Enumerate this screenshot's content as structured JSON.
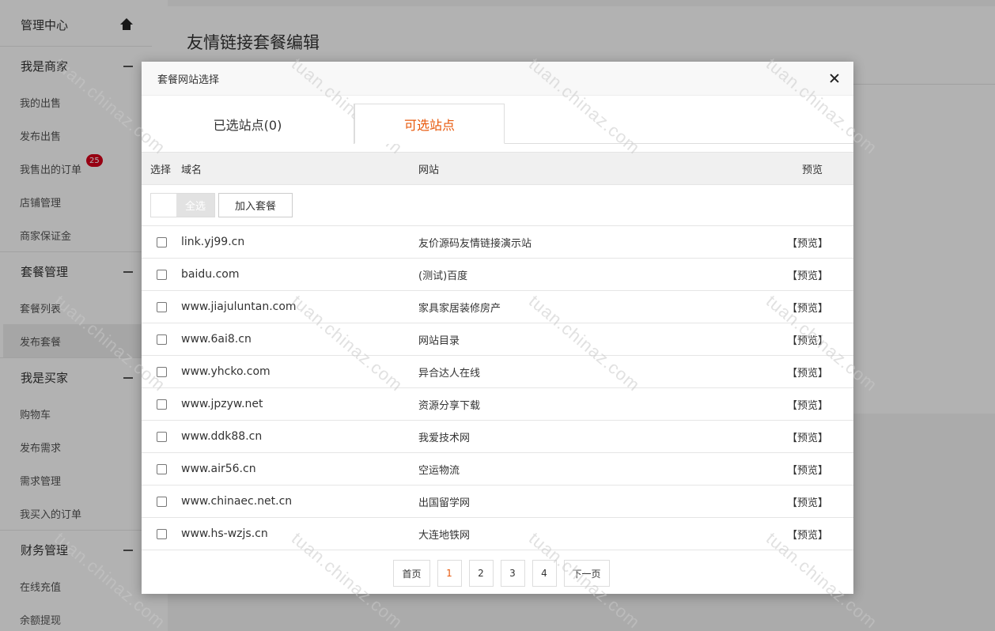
{
  "sidebar": {
    "admin_center": "管理中心",
    "sections": [
      {
        "title": "我是商家",
        "items": [
          {
            "label": "我的出售"
          },
          {
            "label": "发布出售"
          },
          {
            "label": "我售出的订单",
            "badge": "25"
          },
          {
            "label": "店铺管理"
          },
          {
            "label": "商家保证金"
          }
        ]
      },
      {
        "title": "套餐管理",
        "items": [
          {
            "label": "套餐列表"
          },
          {
            "label": "发布套餐",
            "active": true
          }
        ]
      },
      {
        "title": "我是买家",
        "items": [
          {
            "label": "购物车"
          },
          {
            "label": "发布需求"
          },
          {
            "label": "需求管理"
          },
          {
            "label": "我买入的订单"
          }
        ]
      },
      {
        "title": "财务管理",
        "items": [
          {
            "label": "在线充值"
          },
          {
            "label": "余额提现"
          }
        ]
      }
    ]
  },
  "main": {
    "title": "友情链接套餐编辑"
  },
  "modal": {
    "title": "套餐网站选择",
    "tabs": {
      "selected": "已选站点(0)",
      "available": "可选站点"
    },
    "columns": {
      "select": "选择",
      "domain": "域名",
      "site": "网站",
      "preview": "预览"
    },
    "select_all": "全选",
    "add_to_package": "加入套餐",
    "preview_label": "【预览】",
    "rows": [
      {
        "domain": "link.yj99.cn",
        "site": "友价源码友情链接演示站"
      },
      {
        "domain": "baidu.com",
        "site": "(测试)百度"
      },
      {
        "domain": "www.jiajuluntan.com",
        "site": "家具家居装修房产"
      },
      {
        "domain": "www.6ai8.cn",
        "site": "网站目录"
      },
      {
        "domain": "www.yhcko.com",
        "site": "异合达人在线"
      },
      {
        "domain": "www.jpzyw.net",
        "site": "资源分享下载"
      },
      {
        "domain": "www.ddk88.cn",
        "site": "我爱技术网"
      },
      {
        "domain": "www.air56.cn",
        "site": "空运物流"
      },
      {
        "domain": "www.chinaec.net.cn",
        "site": "出国留学网"
      },
      {
        "domain": "www.hs-wzjs.cn",
        "site": "大连地铁网"
      }
    ],
    "pager": {
      "first": "首页",
      "pages": [
        "1",
        "2",
        "3",
        "4"
      ],
      "current": "1",
      "next": "下一页"
    }
  },
  "watermark": "tuan.chinaz.com",
  "colors": {
    "accent": "#e8590c",
    "badge": "#d9001b"
  }
}
